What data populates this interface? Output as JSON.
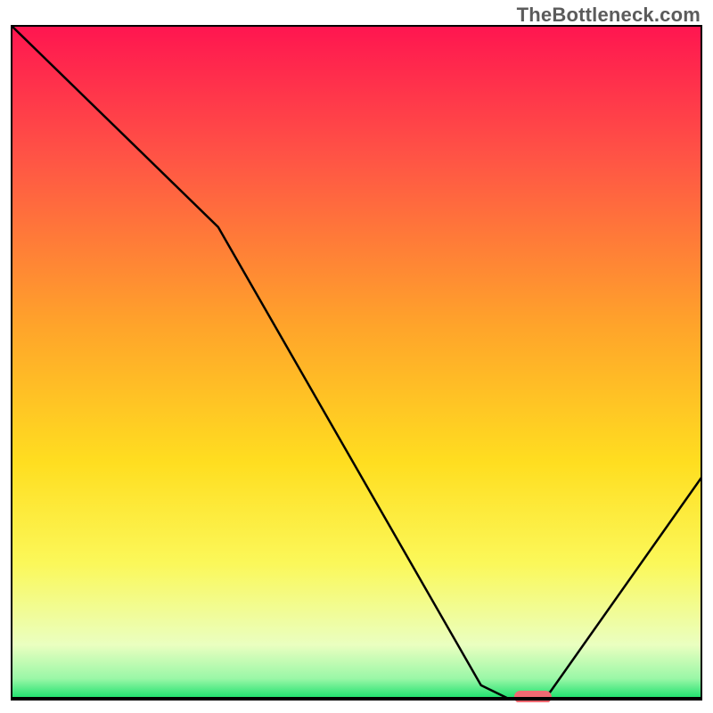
{
  "attribution": "TheBottleneck.com",
  "chart_data": {
    "type": "line",
    "title": "",
    "xlabel": "",
    "ylabel": "",
    "xlim": [
      0,
      100
    ],
    "ylim": [
      0,
      100
    ],
    "grid": false,
    "series": [
      {
        "name": "curve",
        "x": [
          0,
          30,
          68,
          72,
          76,
          78,
          100
        ],
        "values": [
          100,
          70,
          2,
          0,
          0,
          1,
          33
        ]
      }
    ],
    "marker": {
      "x": 75.5,
      "y": 0,
      "color": "#f06a72"
    },
    "background_gradient": {
      "stops": [
        {
          "offset": 0.0,
          "color": "#ff1550"
        },
        {
          "offset": 0.2,
          "color": "#ff5545"
        },
        {
          "offset": 0.45,
          "color": "#ffa52a"
        },
        {
          "offset": 0.65,
          "color": "#ffde20"
        },
        {
          "offset": 0.8,
          "color": "#fbf85a"
        },
        {
          "offset": 0.92,
          "color": "#eaffc0"
        },
        {
          "offset": 0.97,
          "color": "#9af7a7"
        },
        {
          "offset": 1.0,
          "color": "#19e06b"
        }
      ]
    }
  }
}
